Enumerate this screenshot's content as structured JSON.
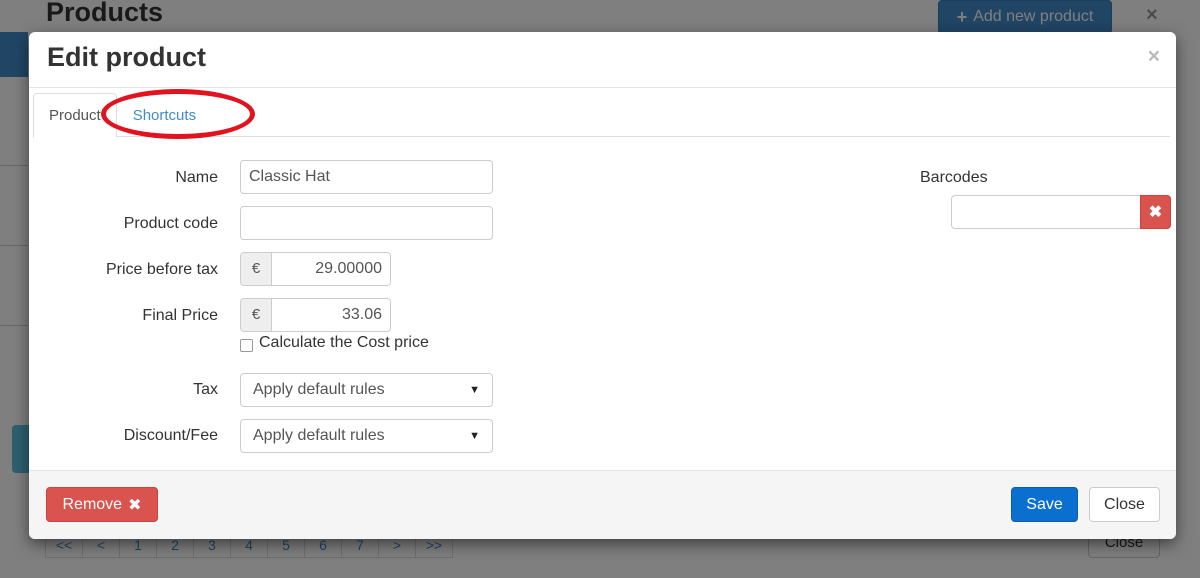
{
  "background": {
    "page_title": "Products",
    "add_button": {
      "icon": "plus-icon",
      "label": "Add new product"
    },
    "pagination": [
      "<<",
      "<",
      "1",
      "2",
      "3",
      "4",
      "5",
      "6",
      "7",
      ">",
      ">>"
    ],
    "close_label": "Close"
  },
  "modal": {
    "title": "Edit product",
    "close_icon": "close-icon",
    "tabs": [
      {
        "label": "Product",
        "active": true
      },
      {
        "label": "Shortcuts",
        "active": false
      }
    ],
    "form": {
      "name": {
        "label": "Name",
        "value": "Classic Hat"
      },
      "product_code": {
        "label": "Product code",
        "value": ""
      },
      "price_before_tax": {
        "label": "Price before tax",
        "currency": "€",
        "value": "29.00000"
      },
      "final_price": {
        "label": "Final Price",
        "currency": "€",
        "value": "33.06"
      },
      "calculate_cost": {
        "label": "Calculate the Cost price",
        "checked": false
      },
      "tax": {
        "label": "Tax",
        "selected": "Apply default rules"
      },
      "discount_fee": {
        "label": "Discount/Fee",
        "selected": "Apply default rules"
      },
      "barcodes": {
        "label": "Barcodes",
        "value": ""
      }
    },
    "footer": {
      "remove_label": "Remove",
      "remove_icon": "times-icon",
      "save_label": "Save",
      "close_label": "Close"
    }
  },
  "colors": {
    "primary": "#428bca",
    "danger": "#d9534f",
    "save": "#0b6fcf",
    "annotation": "#e0131f"
  }
}
